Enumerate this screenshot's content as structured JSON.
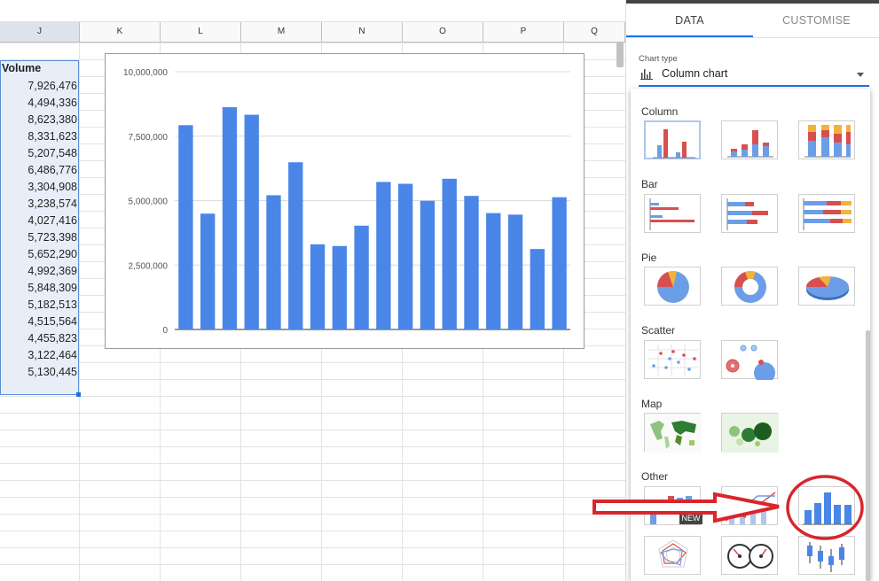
{
  "sheet": {
    "columns": [
      "J",
      "K",
      "L",
      "M",
      "N",
      "O",
      "P",
      "Q"
    ],
    "volume_header": "Volume",
    "volume_values": [
      "7,926,476",
      "4,494,336",
      "8,623,380",
      "8,331,623",
      "5,207,548",
      "6,486,776",
      "3,304,908",
      "3,238,574",
      "4,027,416",
      "5,723,398",
      "5,652,290",
      "4,992,369",
      "5,848,309",
      "5,182,513",
      "4,515,564",
      "4,455,823",
      "3,122,464",
      "5,130,445"
    ]
  },
  "chart_data": {
    "type": "bar",
    "title": "",
    "xlabel": "",
    "ylabel": "",
    "ylim": [
      0,
      10000000
    ],
    "yticks": [
      "0",
      "2,500,000",
      "5,000,000",
      "7,500,000",
      "10,000,000"
    ],
    "ytick_values": [
      0,
      2500000,
      5000000,
      7500000,
      10000000
    ],
    "grid": true,
    "color": "#4a86e8",
    "values": [
      7926476,
      4494336,
      8623380,
      8331623,
      5207548,
      6486776,
      3304908,
      3238574,
      4027416,
      5723398,
      5652290,
      4992369,
      5848309,
      5182513,
      4515564,
      4455823,
      3122464,
      5130445
    ]
  },
  "panel": {
    "tabs": [
      "DATA",
      "CUSTOMISE"
    ],
    "active_tab": "DATA",
    "chart_type_label": "Chart type",
    "chart_type_value": "Column chart",
    "sections": [
      "Column",
      "Bar",
      "Pie",
      "Scatter",
      "Map",
      "Other"
    ],
    "new_badge": "NEW",
    "accent": "#1a73e8",
    "annotation_color": "#d9252b"
  }
}
